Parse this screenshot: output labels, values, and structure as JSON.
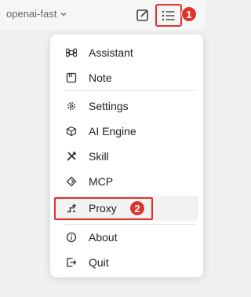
{
  "topbar": {
    "model_name": "openai-fast",
    "chevron_icon": "chevron-down-icon",
    "edit_icon": "edit-icon",
    "menu_icon": "list-icon"
  },
  "annotations": {
    "badge1": "1",
    "badge2": "2"
  },
  "colors": {
    "highlight": "#e0332b"
  },
  "menu": {
    "group1": [
      {
        "label": "Assistant",
        "icon": "command-icon"
      },
      {
        "label": "Note",
        "icon": "note-icon"
      }
    ],
    "group2": [
      {
        "label": "Settings",
        "icon": "gear-icon"
      },
      {
        "label": "AI Engine",
        "icon": "cube-icon"
      },
      {
        "label": "Skill",
        "icon": "tools-icon"
      },
      {
        "label": "MCP",
        "icon": "mcp-icon"
      },
      {
        "label": "Proxy",
        "icon": "proxy-icon"
      }
    ],
    "group3": [
      {
        "label": "About",
        "icon": "info-icon"
      },
      {
        "label": "Quit",
        "icon": "exit-icon"
      }
    ]
  }
}
